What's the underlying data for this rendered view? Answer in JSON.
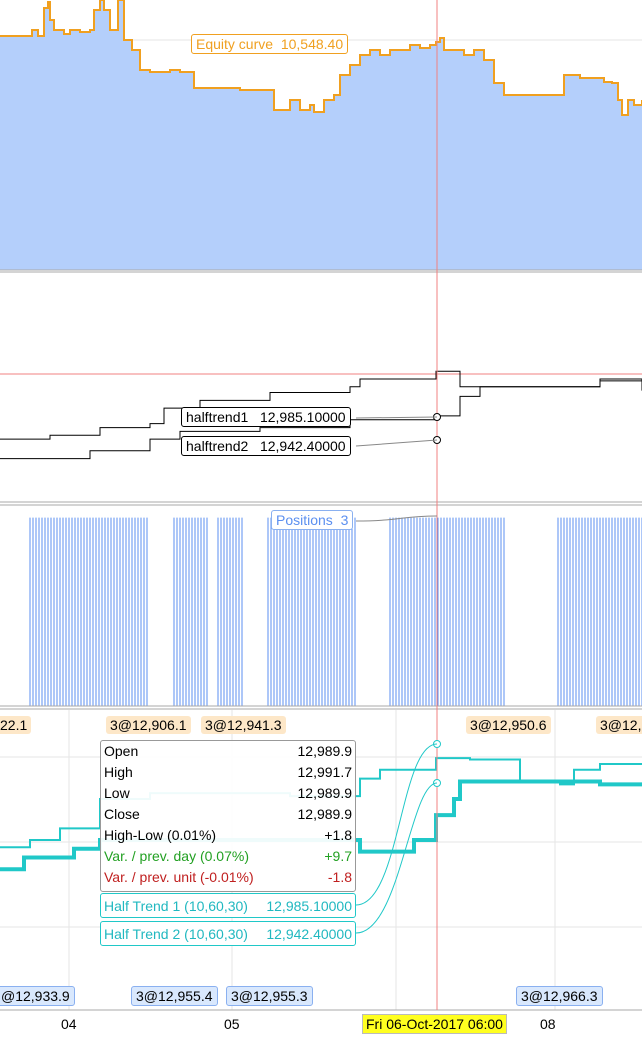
{
  "chart_data": [
    {
      "type": "area",
      "name": "equity",
      "title": "Equity curve",
      "x_unit": "bar",
      "xlim": [
        0,
        321
      ],
      "ylim": [
        10434.4,
        10569.4
      ],
      "color": "#f0a020",
      "fill": "#a8c8fa",
      "x": [
        0,
        14,
        16,
        19,
        22,
        24,
        25,
        27,
        30,
        32,
        35,
        40,
        45,
        47,
        50,
        52,
        55,
        59,
        61,
        62,
        66,
        70,
        75,
        85,
        90,
        95,
        97,
        105,
        120,
        135,
        137,
        145,
        150,
        155,
        157,
        162,
        167,
        170,
        175,
        180,
        185,
        190,
        195,
        200,
        205,
        210,
        215,
        218,
        220,
        222,
        227,
        232,
        237,
        242,
        245,
        247,
        250,
        252,
        280,
        282,
        290,
        297,
        302,
        306,
        309,
        311,
        314,
        317,
        321
      ],
      "y": [
        10551.4,
        10551.4,
        10554.4,
        10551.4,
        10565.4,
        10568.4,
        10559.4,
        10554.4,
        10554.4,
        10552.4,
        10554.4,
        10553.4,
        10554.4,
        10564.4,
        10569.4,
        10564.4,
        10554.4,
        10569.4,
        10569.4,
        10549.4,
        10544.4,
        10534.4,
        10533.4,
        10534.4,
        10533.4,
        10533.4,
        10525.4,
        10525.4,
        10524.4,
        10524.4,
        10514.4,
        10519.4,
        10514.4,
        10516.9,
        10513.4,
        10519.4,
        10521.9,
        10531.9,
        10536.9,
        10541.9,
        10544.4,
        10541.9,
        10544.4,
        10544.4,
        10546.9,
        10545.4,
        10546.9,
        10548.4,
        10550.4,
        10544.4,
        10544.4,
        10541.9,
        10544.4,
        10539.4,
        10539.4,
        10527.9,
        10527.9,
        10521.9,
        10521.9,
        10531.9,
        10530.4,
        10530.4,
        10528.4,
        10527.9,
        10519.4,
        10511.9,
        10519.4,
        10516.9,
        10519.4
      ],
      "label": "Equity curve",
      "label_value": "10,548.40"
    },
    {
      "type": "line",
      "name": "halftrend",
      "xlim": [
        0,
        321
      ],
      "ylim": [
        12860,
        13080
      ],
      "series": [
        {
          "name": "halftrend1",
          "value_label": "12,985.10000",
          "x": [
            0,
            25,
            50,
            75,
            82,
            100,
            135,
            175,
            180,
            218,
            230,
            300,
            321
          ],
          "y": [
            12920.1,
            12923.8,
            12931.2,
            12935.0,
            12949.8,
            12957.2,
            12964.7,
            12970.2,
            12977.7,
            12985.1,
            12970.2,
            12977.7,
            12966.5
          ]
        },
        {
          "name": "halftrend2",
          "value_label": "12,942.40000",
          "x": [
            0,
            45,
            75,
            90,
            130,
            175,
            218,
            230,
            240,
            300,
            321
          ],
          "y": [
            12901.5,
            12909.0,
            12920.1,
            12927.5,
            12931.2,
            12938.7,
            12942.4,
            12961.0,
            12970.2,
            12975.8,
            12970.2
          ]
        }
      ]
    },
    {
      "type": "bar",
      "name": "positions",
      "label": "Positions",
      "label_value": "3",
      "xlim": [
        0,
        321
      ],
      "ylim": [
        0,
        3.2
      ],
      "color": "#5b8ff0",
      "ranges": [
        [
          15,
          74
        ],
        [
          87,
          104
        ],
        [
          109,
          121
        ],
        [
          134,
          178
        ],
        [
          195,
          253
        ],
        [
          279,
          321
        ]
      ],
      "value": 3
    },
    {
      "type": "line",
      "name": "price",
      "xlim": [
        0,
        321
      ],
      "ylim": [
        12780,
        13030
      ],
      "series": [
        {
          "name": "Half Trend 1 (10,60,30)",
          "x": [
            0,
            15,
            30,
            45,
            50,
            75,
            125,
            145,
            180,
            190,
            218,
            235,
            255,
            260,
            280,
            287,
            300,
            321
          ],
          "y": [
            12915.6,
            12921.7,
            12931.4,
            12931.4,
            12955.8,
            12960.7,
            12960.7,
            12958.2,
            12972.8,
            12980.2,
            12989.9,
            12988.7,
            12988.7,
            12970.4,
            12968.0,
            12980.2,
            12985.0,
            12985.0
          ]
        },
        {
          "name": "Half Trend 2 (10,60,30)",
          "x": [
            0,
            10,
            12,
            35,
            37,
            50,
            180,
            207,
            218,
            227,
            230,
            290,
            300,
            321
          ],
          "y": [
            12897.3,
            12897.3,
            12907.1,
            12907.1,
            12914.4,
            12921.7,
            12912.0,
            12921.7,
            12942.4,
            12955.8,
            12970.4,
            12970.4,
            12968.0,
            12968.0
          ]
        }
      ]
    }
  ],
  "equity_label": {
    "name": "Equity curve",
    "value": "10,548.40"
  },
  "halftrend1": {
    "name": "halftrend1",
    "value": "12,985.10000"
  },
  "halftrend2": {
    "name": "halftrend2",
    "value": "12,942.40000"
  },
  "positions": {
    "name": "Positions",
    "value": "3"
  },
  "tooltip": {
    "rows": [
      {
        "label": "Open",
        "value": "12,989.9"
      },
      {
        "label": "High",
        "value": "12,991.7"
      },
      {
        "label": "Low",
        "value": "12,989.9"
      },
      {
        "label": "Close",
        "value": "12,989.9"
      },
      {
        "label": "High-Low (0.01%)",
        "value": "+1.8"
      },
      {
        "label": "Var. / prev. day (0.07%)",
        "value": "+9.7"
      },
      {
        "label": "Var. / prev. unit (-0.01%)",
        "value": "-1.8"
      }
    ],
    "ht1": {
      "label": "Half Trend 1 (10,60,30)",
      "value": "12,985.10000"
    },
    "ht2": {
      "label": "Half Trend 2 (10,60,30)",
      "value": "12,942.40000"
    }
  },
  "sell_labels": [
    "22.1",
    "3@12,906.1",
    "3@12,941.3",
    "3@12,950.6",
    "3@12,"
  ],
  "buy_labels": [
    "@12,933.9",
    "3@12,955.4",
    "3@12,955.3",
    "3@12,966.3"
  ],
  "x_ticks": [
    "04",
    "05",
    "08"
  ],
  "cursor_time": "Fri 06-Oct-2017 06:00"
}
